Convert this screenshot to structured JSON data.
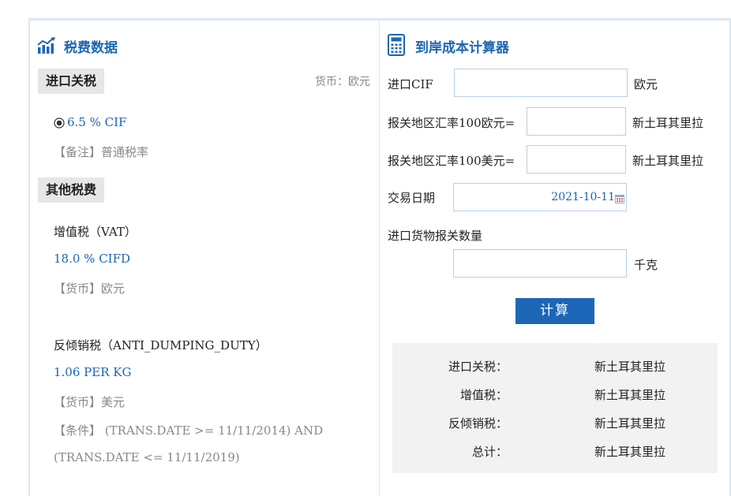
{
  "left": {
    "title": "税费数据",
    "import_tag": "进口关税",
    "currency_note": "货币：欧元",
    "rate_option": "6.5 % CIF",
    "remark": "【备注】普通税率",
    "other_tag": "其他税费",
    "vat_name": "增值税（VAT）",
    "vat_rate": "18.0 % CIFD",
    "vat_currency": "【货币】欧元",
    "ad_name": "反倾销税（ANTI_DUMPING_DUTY）",
    "ad_rate": "1.06 PER KG",
    "ad_currency": "【货币】美元",
    "ad_condition_prefix": "【条件】",
    "ad_condition_1": "(TRANS.DATE >= 11/11/2014) AND",
    "ad_condition_2": "(TRANS.DATE <= 11/11/2019)"
  },
  "right": {
    "title": "到岸成本计算器",
    "cif_label": "进口CIF",
    "cif_unit": "欧元",
    "eur_rate_label": "报关地区汇率100欧元=",
    "eur_rate_unit": "新土耳其里拉",
    "usd_rate_label": "报关地区汇率100美元=",
    "usd_rate_unit": "新土耳其里拉",
    "date_label": "交易日期",
    "date_value": "2021-10-11",
    "qty_label": "进口货物报关数量",
    "qty_unit": "千克",
    "calc_button": "计算",
    "results": [
      {
        "label": "进口关税：",
        "value": "新土耳其里拉"
      },
      {
        "label": "增值税：",
        "value": "新土耳其里拉"
      },
      {
        "label": "反倾销税：",
        "value": "新土耳其里拉"
      },
      {
        "label": "总计：",
        "value": "新土耳其里拉"
      }
    ]
  },
  "colors": {
    "accent": "#1b66b3",
    "button": "#1d66b7",
    "border": "#dbe7f2",
    "tag_bg": "#e6e6e6",
    "result_bg": "#f2f2f2"
  },
  "icons": {
    "left_title": "chart-trend-icon",
    "right_title": "calculator-icon",
    "date": "calendar-icon",
    "radio": "radio-selected-icon"
  }
}
